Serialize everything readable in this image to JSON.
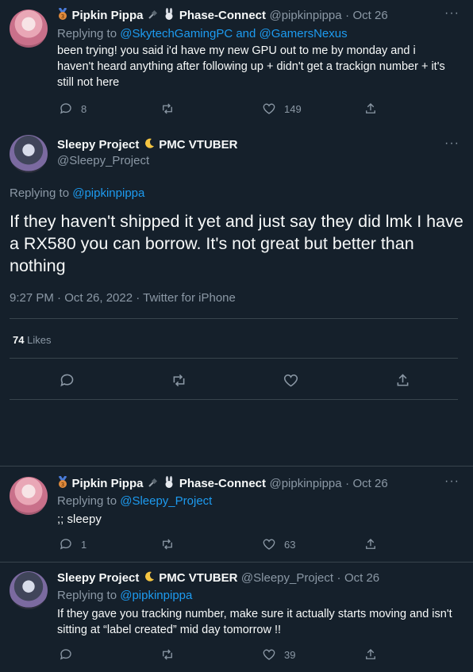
{
  "tweets": [
    {
      "author": "Pipkin Pippa",
      "affiliation": "Phase-Connect",
      "handle": "@pipkinpippa",
      "date": "Oct 26",
      "replying_prefix": "Replying to ",
      "replying_to": "@SkytechGamingPC and @GamersNexus",
      "text": "been trying! you said i'd have my new GPU out to me by monday and i haven't heard anything after following up + didn't get a trackign number + it's still not here",
      "replies": "8",
      "likes": "149"
    },
    {
      "author": "Sleepy Project",
      "affiliation": "PMC VTUBER",
      "handle": "@pipkinpippa",
      "date": "Oct 26",
      "replying_prefix": "Replying to ",
      "replying_to": "@Sleepy_Project",
      "text": ";; sleepy",
      "replies": "1",
      "likes": "63"
    }
  ],
  "main_tweet": {
    "author": "Sleepy Project",
    "affiliation": "PMC VTUBER",
    "handle": "@Sleepy_Project",
    "replying_prefix": "Replying to ",
    "replying_to": "@pipkinpippa",
    "text": "If they haven't shipped it yet and just say they did lmk I have a RX580 you can borrow. It's not great but better than nothing",
    "timestamp": "9:27 PM · Oct 26, 2022 · Twitter for iPhone",
    "likes_count": "74",
    "likes_label": "Likes"
  },
  "reply2": {
    "author": "Pipkin Pippa",
    "affiliation": "Phase-Connect",
    "handle": "@pipkinpippa",
    "date": "Oct 26",
    "replying_prefix": "Replying to ",
    "replying_to": "@Sleepy_Project",
    "text": ";; sleepy",
    "replies": "1",
    "likes": "63"
  },
  "reply3": {
    "author": "Sleepy Project",
    "affiliation": "PMC VTUBER",
    "handle": "@Sleepy_Project",
    "date": "Oct 26",
    "replying_prefix": "Replying to ",
    "replying_to": "@pipkinpippa",
    "text": "If they gave you tracking number, make sure it actually starts moving and isn't sitting at “label created” mid day tomorrow !!",
    "likes": "39"
  },
  "separator": "·",
  "more": "···",
  "colors": {
    "background": "#15202b",
    "link": "#1d9bf0",
    "muted": "#8b98a5",
    "divider": "#38444d"
  }
}
